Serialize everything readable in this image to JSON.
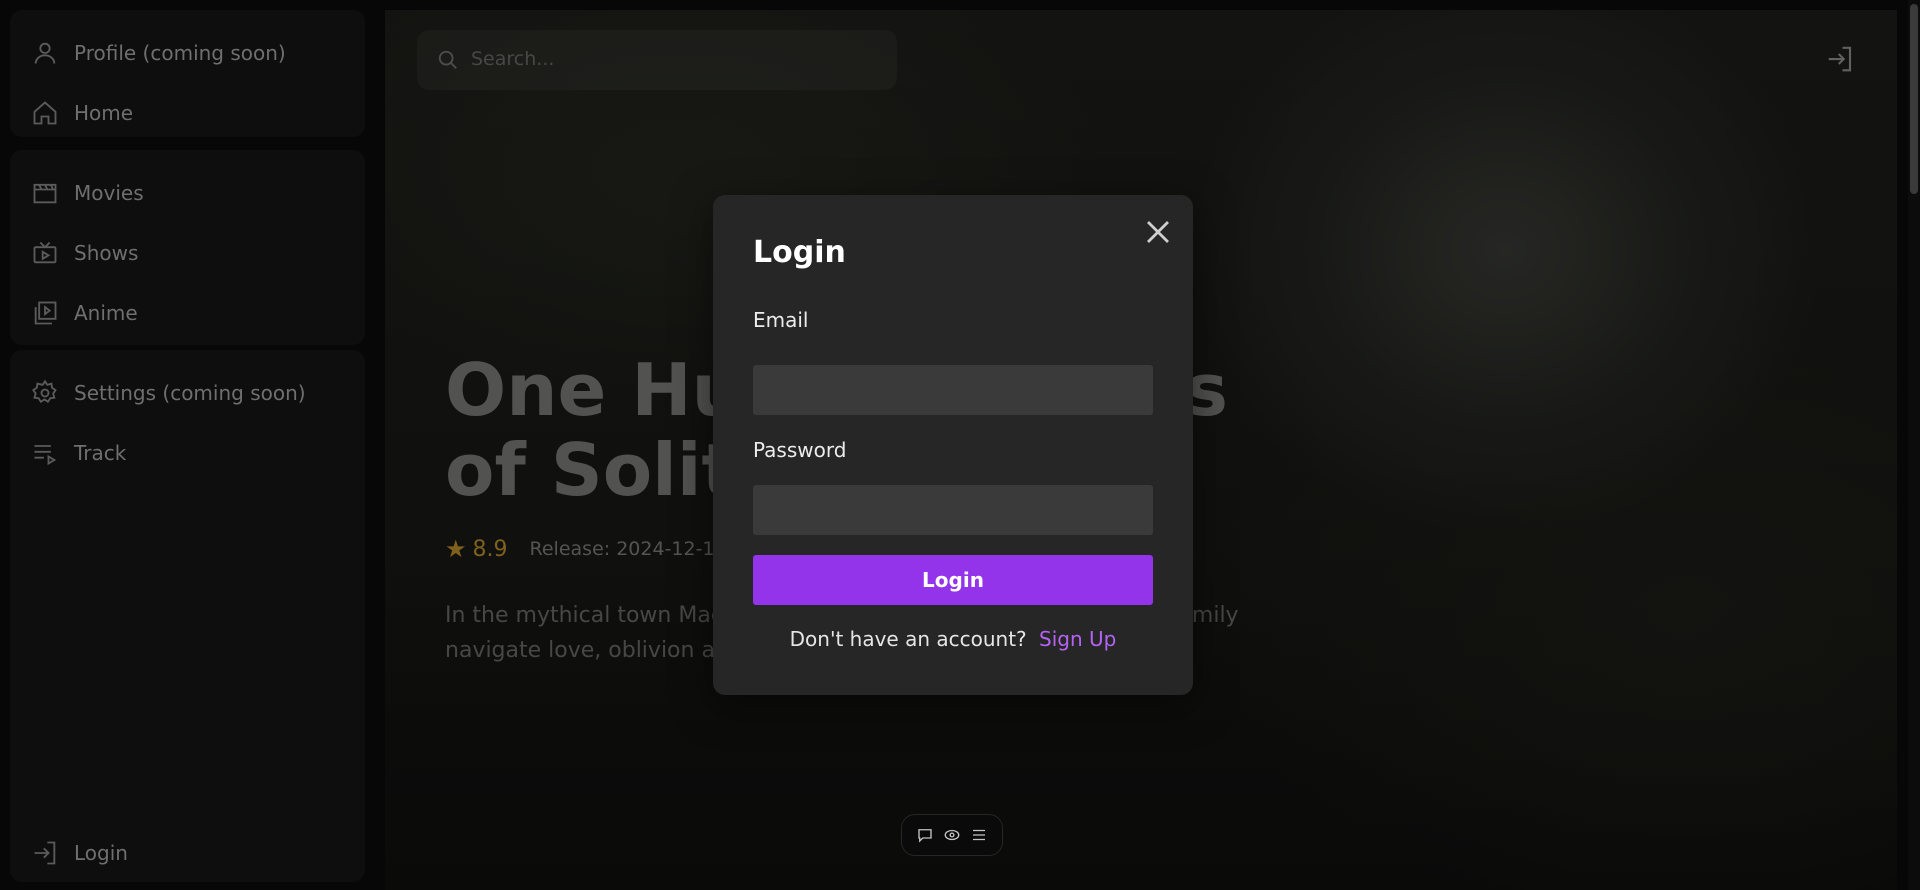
{
  "sidebar": {
    "items": [
      {
        "label": "Profile (coming soon)",
        "icon": "user-icon"
      },
      {
        "label": "Home",
        "icon": "home-icon"
      },
      {
        "label": "Movies",
        "icon": "clapperboard-icon"
      },
      {
        "label": "Shows",
        "icon": "tv-icon"
      },
      {
        "label": "Anime",
        "icon": "play-stack-icon"
      },
      {
        "label": "Settings (coming soon)",
        "icon": "gear-icon"
      },
      {
        "label": "Track",
        "icon": "list-play-icon"
      },
      {
        "label": "Login",
        "icon": "login-icon"
      }
    ]
  },
  "header": {
    "search_placeholder": "Search...",
    "login_icon": "login-icon"
  },
  "hero": {
    "title": "One Hundred Years of Solitude",
    "rating": "8.9",
    "release": "Release: 2024-12-11",
    "overview": "In the mythical town Macondo, seven generations of the Buendía family navigate love, oblivion and the inescapable repetition of their fate.",
    "rating_color": "#8a6a1e"
  },
  "toolbar": {
    "icons": [
      "comment-icon",
      "eye-icon",
      "menu-icon"
    ]
  },
  "modal": {
    "title": "Login",
    "email_label": "Email",
    "email_value": "",
    "password_label": "Password",
    "password_value": "",
    "submit_label": "Login",
    "signup_prompt": "Don't have an account?",
    "signup_link": "Sign Up",
    "accent": "#9333ea",
    "link_color": "#b463f5"
  }
}
